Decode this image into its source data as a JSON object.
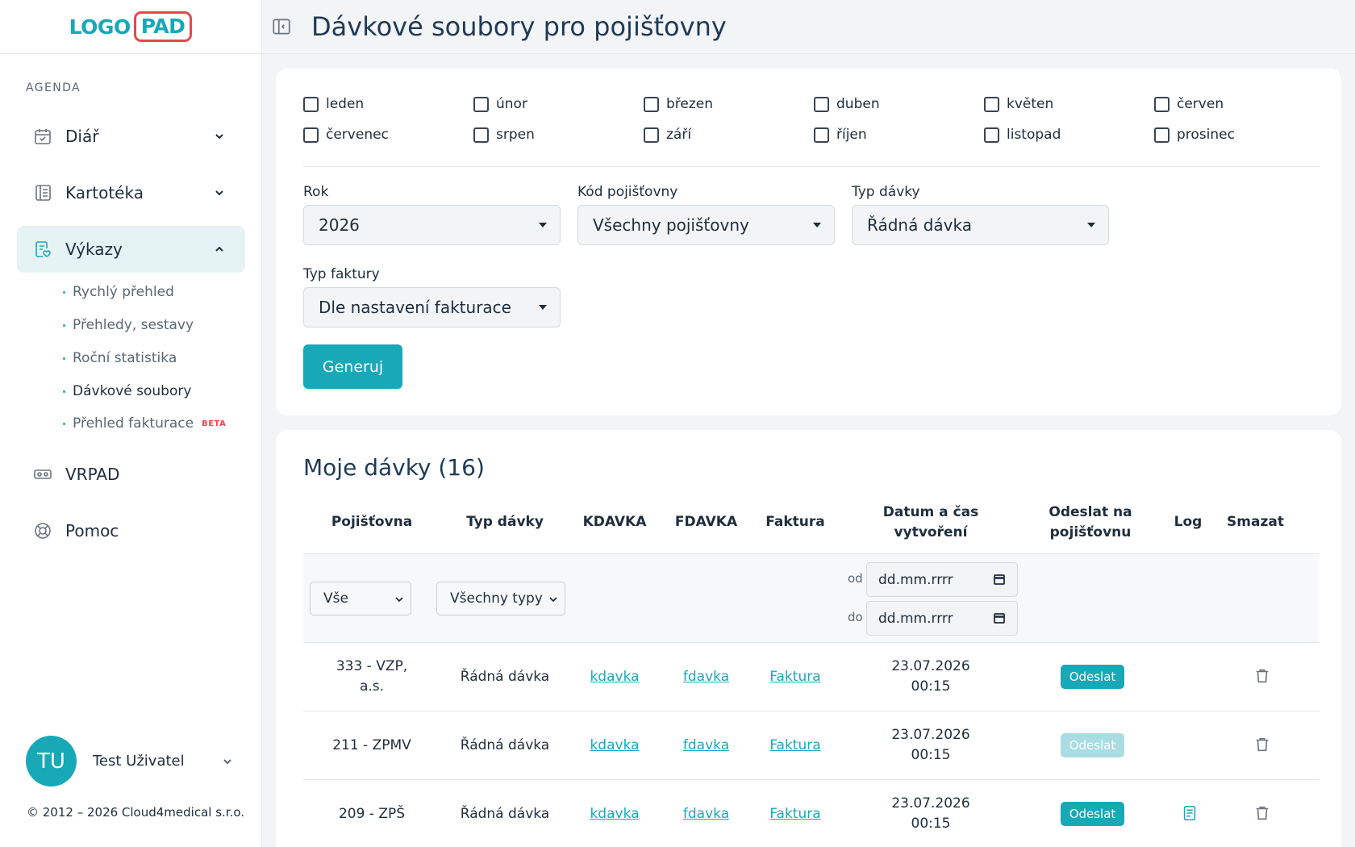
{
  "logo": {
    "part1": "LOGO",
    "part2": "PAD"
  },
  "sidebar": {
    "section_label": "AGENDA",
    "items": [
      {
        "label": "Diář"
      },
      {
        "label": "Kartotéka"
      },
      {
        "label": "Výkazy"
      },
      {
        "label": "VRPAD"
      },
      {
        "label": "Pomoc"
      }
    ],
    "sub_items": [
      {
        "label": "Rychlý přehled"
      },
      {
        "label": "Přehledy, sestavy"
      },
      {
        "label": "Roční statistika"
      },
      {
        "label": "Dávkové soubory"
      },
      {
        "label": "Přehled fakturace",
        "badge": "BETA"
      }
    ],
    "user": {
      "initials": "TU",
      "name": "Test Uživatel"
    },
    "copyright": "© 2012 – 2026 Cloud4medical s.r.o."
  },
  "header": {
    "title": "Dávkové soubory pro pojišťovny"
  },
  "filters": {
    "months": [
      "leden",
      "únor",
      "březen",
      "duben",
      "květen",
      "červen",
      "červenec",
      "srpen",
      "září",
      "říjen",
      "listopad",
      "prosinec"
    ],
    "year_label": "Rok",
    "year_value": "2026",
    "insurer_label": "Kód pojišťovny",
    "insurer_value": "Všechny pojišťovny",
    "batch_type_label": "Typ dávky",
    "batch_type_value": "Řádná dávka",
    "invoice_type_label": "Typ faktury",
    "invoice_type_value": "Dle nastavení fakturace",
    "generate_label": "Generuj"
  },
  "batches": {
    "title": "Moje dávky (16)",
    "columns": {
      "insurer": "Pojišťovna",
      "type": "Typ dávky",
      "kdavka": "KDAVKA",
      "fdavka": "FDAVKA",
      "invoice": "Faktura",
      "created_1": "Datum a čas",
      "created_2": "vytvoření",
      "send_1": "Odeslat na",
      "send_2": "pojišťovnu",
      "log": "Log",
      "delete": "Smazat"
    },
    "table_filters": {
      "insurer": "Vše",
      "type": "Všechny typy",
      "from_label": "od",
      "to_label": "do",
      "date_placeholder": "dd.mm.rrrr"
    },
    "rows": [
      {
        "insurer_1": "333 - VZP,",
        "insurer_2": "a.s.",
        "type": "Řádná dávka",
        "kdavka": "kdavka",
        "fdavka": "fdavka",
        "invoice": "Faktura",
        "date": "23.07.2026",
        "time": "00:15",
        "send": "Odeslat"
      },
      {
        "insurer_1": "211 - ZPMV",
        "insurer_2": "",
        "type": "Řádná dávka",
        "kdavka": "kdavka",
        "fdavka": "fdavka",
        "invoice": "Faktura",
        "date": "23.07.2026",
        "time": "00:15",
        "send": "Odeslat"
      },
      {
        "insurer_1": "209 - ZPŠ",
        "insurer_2": "",
        "type": "Řádná dávka",
        "kdavka": "kdavka",
        "fdavka": "fdavka",
        "invoice": "Faktura",
        "date": "23.07.2026",
        "time": "00:15",
        "send": "Odeslat"
      }
    ]
  }
}
